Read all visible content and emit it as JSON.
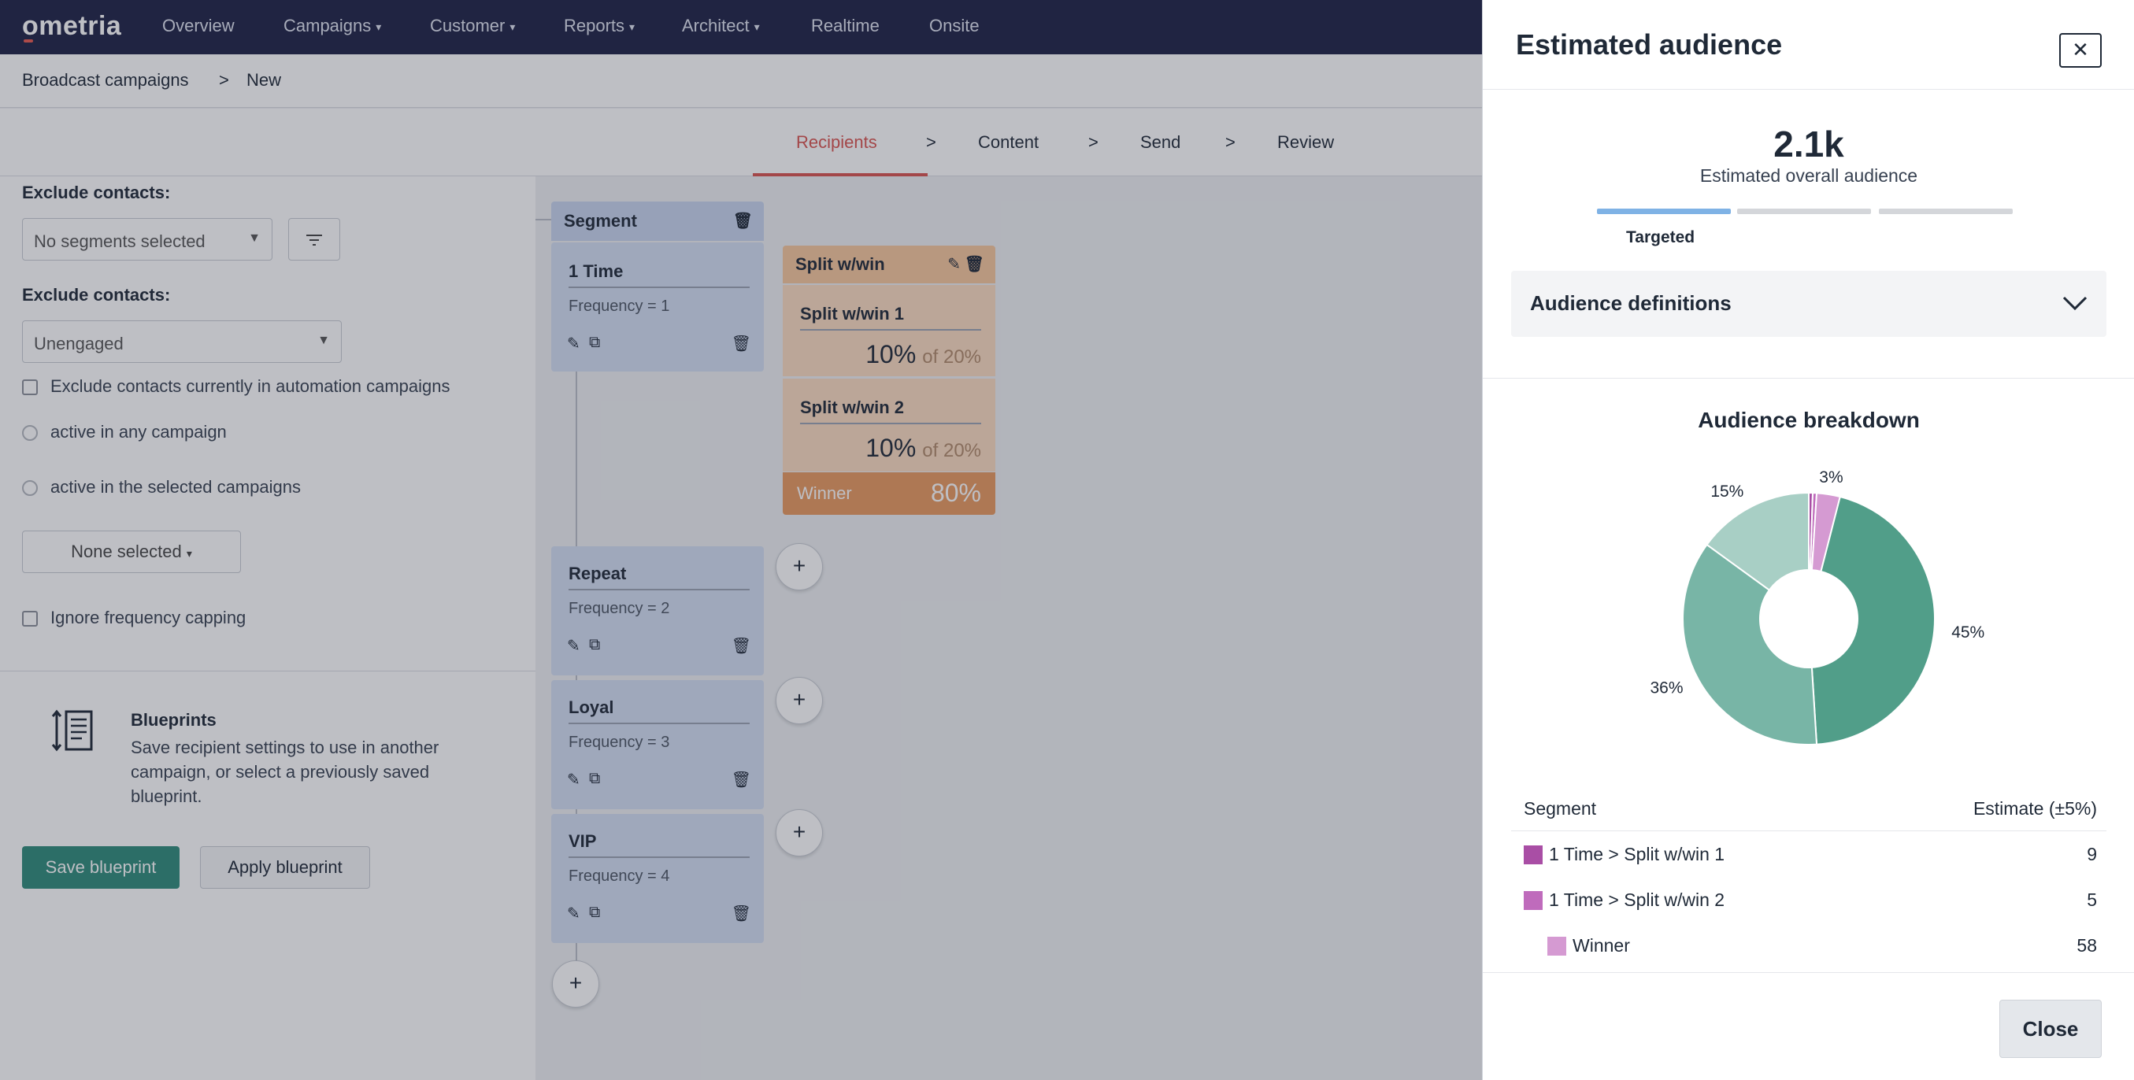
{
  "brand": {
    "logo": "ometria"
  },
  "nav": {
    "items": [
      {
        "label": "Overview",
        "caret": false
      },
      {
        "label": "Campaigns",
        "caret": true
      },
      {
        "label": "Customer",
        "caret": true
      },
      {
        "label": "Reports",
        "caret": true
      },
      {
        "label": "Architect",
        "caret": true
      },
      {
        "label": "Realtime",
        "caret": false
      },
      {
        "label": "Onsite",
        "caret": false
      }
    ]
  },
  "breadcrumb": {
    "parent": "Broadcast campaigns",
    "separator": ">",
    "current": "New"
  },
  "steps": {
    "items": [
      "Recipients",
      "Content",
      "Send",
      "Review"
    ],
    "separator": ">",
    "active": "Recipients"
  },
  "left": {
    "exclude_label_1": "Exclude contacts:",
    "segments_select": "No segments selected",
    "exclude_label_2": "Exclude contacts:",
    "engagement_select": "Unengaged",
    "exclude_automation": "Exclude contacts currently in automation campaigns",
    "radio_any": "active in any campaign",
    "radio_selected": "active in the selected campaigns",
    "none_selected": "None selected",
    "ignore_capping": "Ignore frequency capping",
    "blueprints": {
      "title": "Blueprints",
      "description": "Save recipient settings to use in another campaign, or select a previously saved blueprint.",
      "save_label": "Save blueprint",
      "apply_label": "Apply blueprint"
    }
  },
  "canvas": {
    "segment_header": "Segment",
    "cards": [
      {
        "title": "1 Time",
        "freq": "Frequency = 1"
      },
      {
        "title": "Repeat",
        "freq": "Frequency = 2"
      },
      {
        "title": "Loyal",
        "freq": "Frequency = 3"
      },
      {
        "title": "VIP",
        "freq": "Frequency = 4"
      }
    ],
    "split": {
      "header": "Split w/win",
      "items": [
        {
          "title": "Split w/win 1",
          "pct": "10%",
          "of": "of 20%"
        },
        {
          "title": "Split w/win 2",
          "pct": "10%",
          "of": "of 20%"
        }
      ],
      "winner_label": "Winner",
      "winner_pct": "80%"
    }
  },
  "drawer": {
    "title": "Estimated audience",
    "big_number": "2.1k",
    "big_sub": "Estimated overall audience",
    "targeted_label": "Targeted",
    "definitions_label": "Audience definitions",
    "breakdown_title": "Audience breakdown",
    "table": {
      "col_segment": "Segment",
      "col_estimate": "Estimate (±5%)",
      "rows": [
        {
          "label": "1 Time > Split w/win 1",
          "value": "9",
          "color": "#a94ea5",
          "indent": false
        },
        {
          "label": "1 Time > Split w/win 2",
          "value": "5",
          "color": "#bf6bbc",
          "indent": false
        },
        {
          "label": "Winner",
          "value": "58",
          "color": "#d59ad2",
          "indent": true
        }
      ]
    },
    "close_label": "Close"
  },
  "chart_data": {
    "type": "pie",
    "title": "Audience breakdown",
    "slices": [
      {
        "label": "45%",
        "value": 45,
        "color": "#519e89"
      },
      {
        "label": "36%",
        "value": 36,
        "color": "#78b5a6"
      },
      {
        "label": "15%",
        "value": 15,
        "color": "#a8cfc5"
      },
      {
        "label": "",
        "value": 0.5,
        "color": "#a94ea5"
      },
      {
        "label": "",
        "value": 0.5,
        "color": "#bf6bbc"
      },
      {
        "label": "3%",
        "value": 3,
        "color": "#d59ad2"
      }
    ]
  },
  "colors": {
    "nav_bg": "#1d2246",
    "accent_red": "#d9534f",
    "save_green": "#2e8b7a",
    "segment_blue": "#d3def2",
    "split_orange": "#fbdcc0",
    "winner_orange": "#e99a5f"
  }
}
